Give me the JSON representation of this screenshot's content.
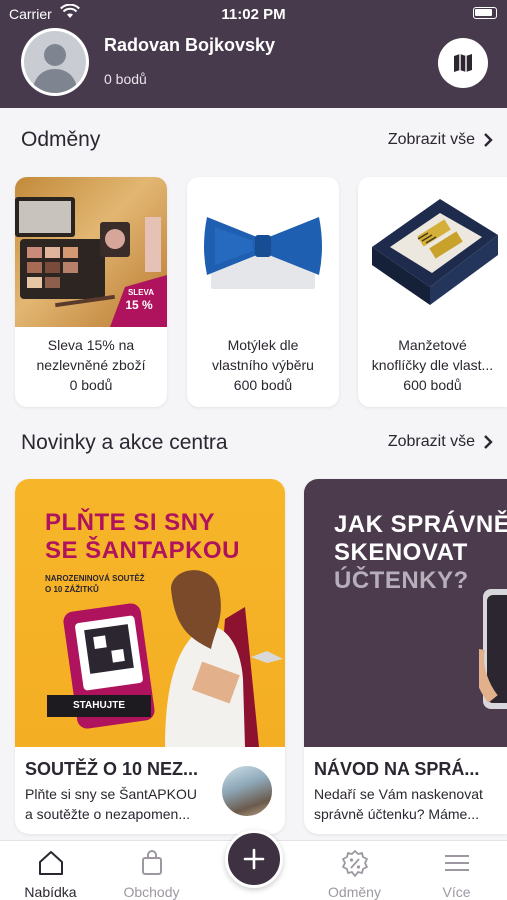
{
  "status": {
    "carrier": "Carrier",
    "time": "11:02 PM"
  },
  "profile": {
    "name": "Radovan Bojkovsky",
    "points": "0 bodů"
  },
  "rewards": {
    "title": "Odměny",
    "show_all": "Zobrazit vše",
    "items": [
      {
        "line1": "Sleva 15% na",
        "line2": "nezlevněné zboží",
        "points": "0 bodů",
        "badge": "SLEVA 15 %"
      },
      {
        "line1": "Motýlek dle",
        "line2": "vlastního výběru",
        "points": "600 bodů"
      },
      {
        "line1": "Manžetové",
        "line2": "knoflíčky dle vlast...",
        "points": "600 bodů"
      }
    ]
  },
  "news": {
    "title": "Novinky a akce centra",
    "show_all": "Zobrazit vše",
    "items": [
      {
        "banner_line1": "PLŇTE SI SNY",
        "banner_line2": "SE ŠANTAPKOU",
        "banner_sub1": "NAROZENINOVÁ SOUTĚŽ",
        "banner_sub2": "O 10 ZÁŽITKŮ",
        "banner_button": "STAHUJTE",
        "title": "SOUTĚŽ O 10 NEZ...",
        "desc_line1": "Plňte si sny se ŠantAPKOU",
        "desc_line2": "a soutěžte o nezapomen..."
      },
      {
        "banner_line1": "JAK SPRÁVNĚ",
        "banner_line2": "SKENOVAT",
        "banner_line3": "ÚČTENKY?",
        "title": "NÁVOD NA SPRÁ...",
        "desc_line1": "Nedaří se Vám naskenovat",
        "desc_line2": "správně účtenku? Máme..."
      }
    ]
  },
  "nav": {
    "items": [
      {
        "label": "Nabídka",
        "icon": "home-icon",
        "active": true
      },
      {
        "label": "Obchody",
        "icon": "shopping-bag-icon"
      },
      {
        "label": "Odměny",
        "icon": "discount-badge-icon"
      },
      {
        "label": "Více",
        "icon": "menu-icon"
      }
    ],
    "add_icon": "plus-icon"
  },
  "colors": {
    "header": "#473a4c",
    "accent": "#3d3142",
    "banner_yellow": "#f6b324",
    "banner_magenta": "#b0135d"
  }
}
